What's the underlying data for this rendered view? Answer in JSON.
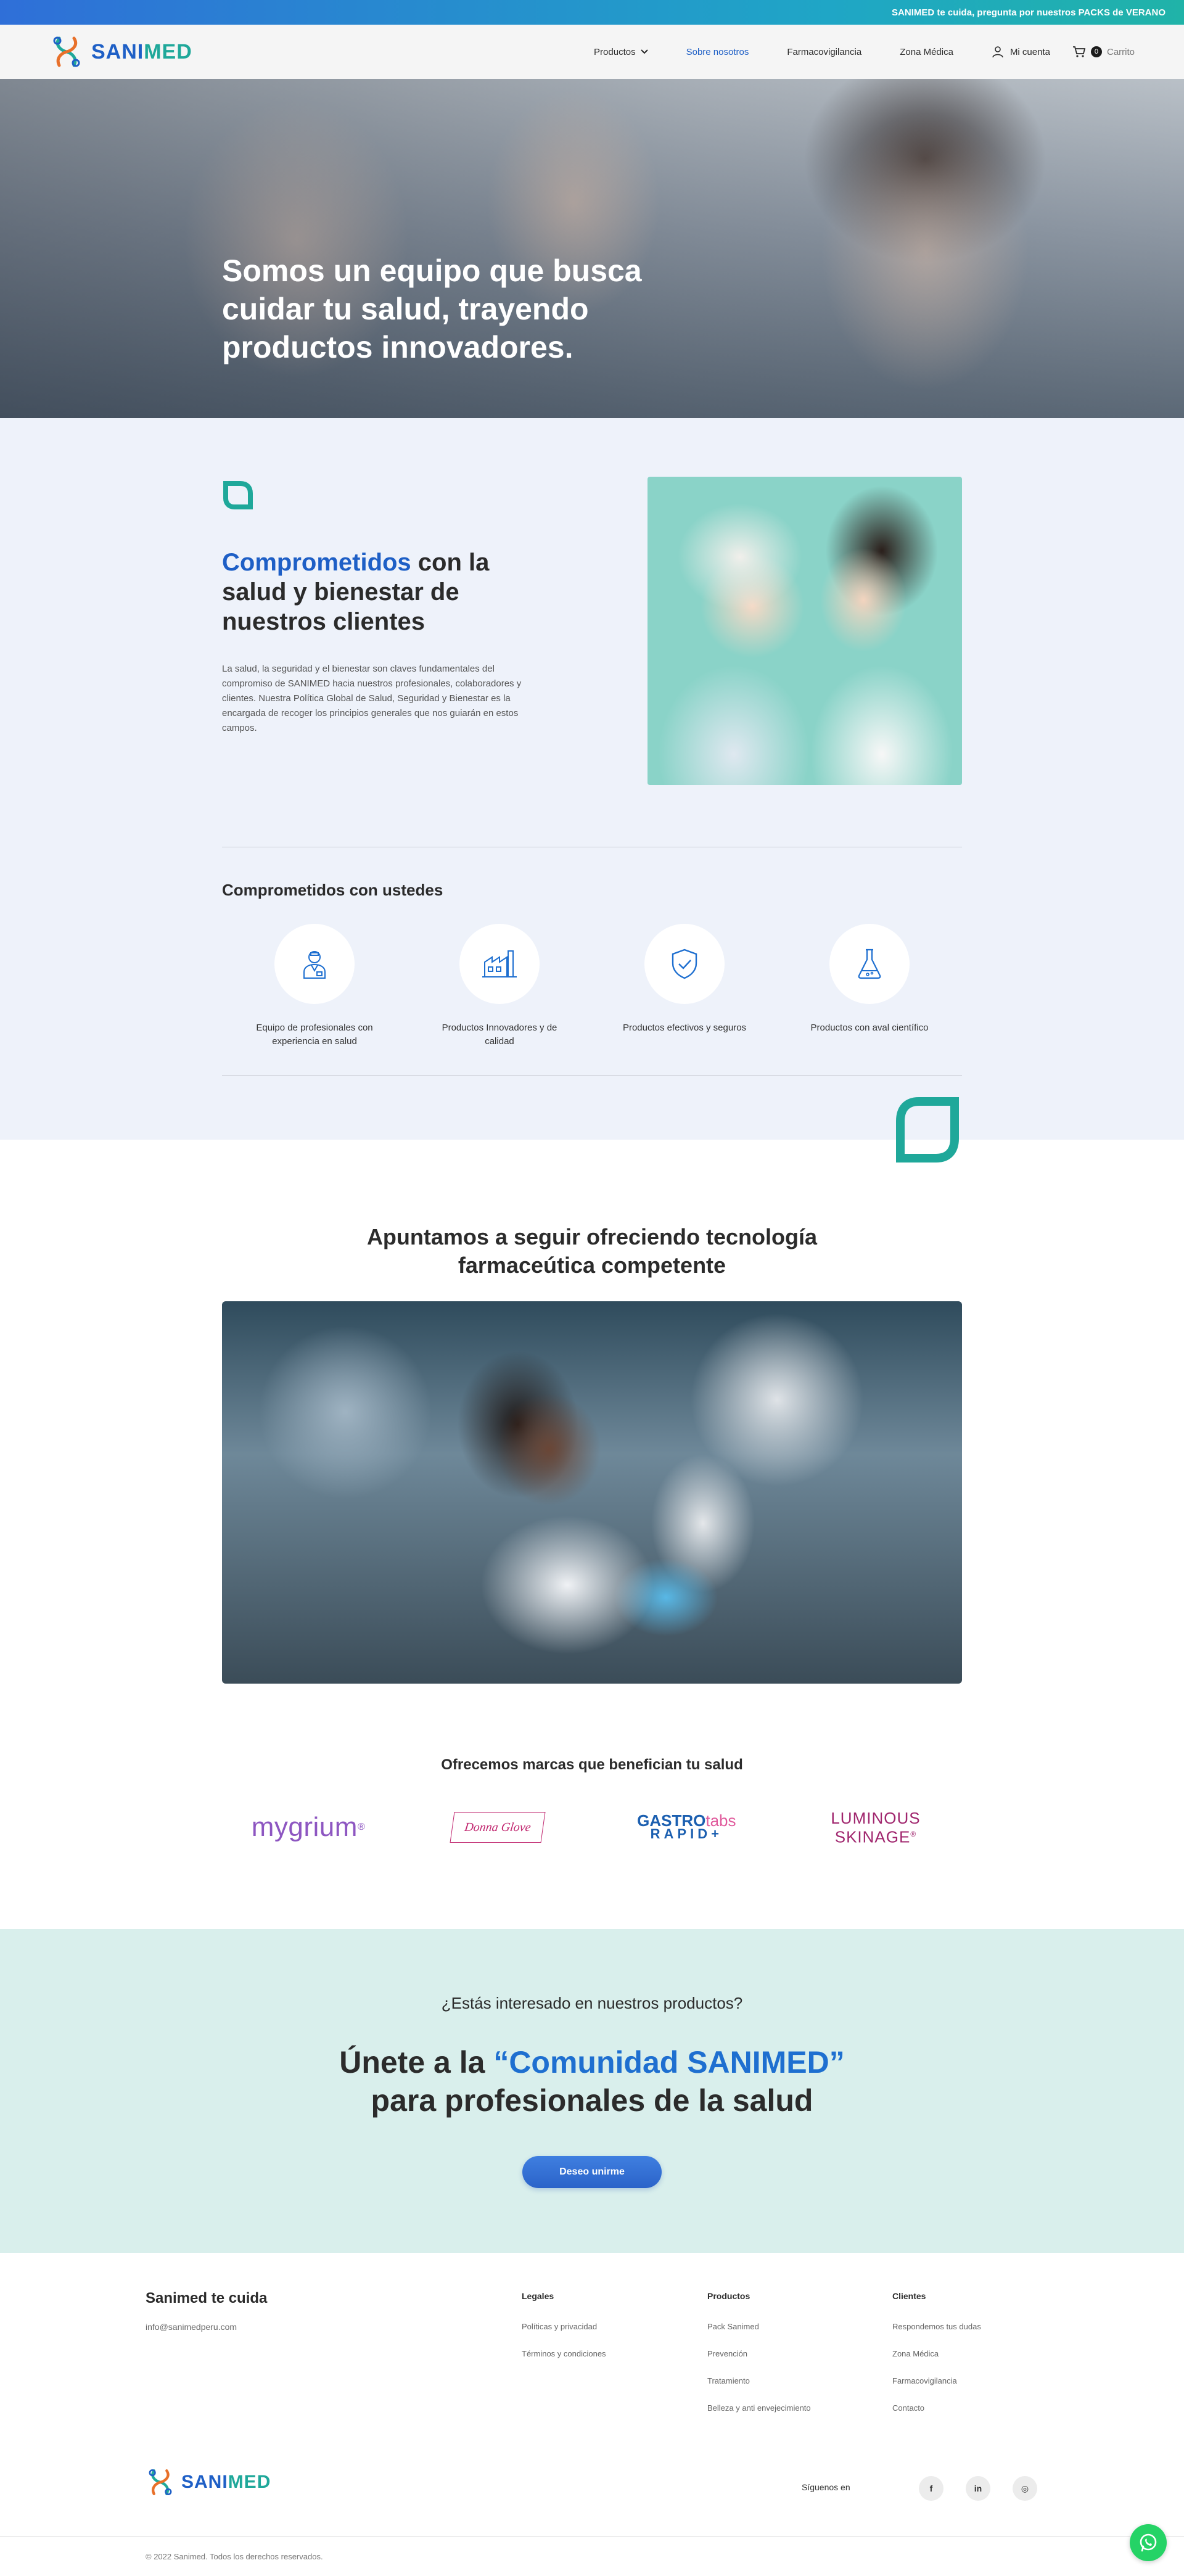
{
  "announcement": "SANIMED te cuida, pregunta por nuestros PACKS de VERANO",
  "brand": {
    "part1": "SANI",
    "part2": "MED",
    "color_primary": "#1e5fc6",
    "color_secondary": "#1fa89a"
  },
  "nav": {
    "items": [
      {
        "label": "Productos",
        "has_dropdown": true
      },
      {
        "label": "Sobre nosotros",
        "active": true
      },
      {
        "label": "Farmacovigilancia"
      },
      {
        "label": "Zona Médica"
      }
    ],
    "account_label": "Mi cuenta",
    "cart_count": "0",
    "cart_label": "Carrito"
  },
  "hero": {
    "title": "Somos un equipo que busca cuidar tu salud, trayendo productos innovadores."
  },
  "commit": {
    "title_highlight": "Comprometidos",
    "title_rest": " con la salud y bienestar de nuestros clientes",
    "text": "La salud, la seguridad y el bienestar son claves fundamentales del compromiso de SANIMED hacia nuestros profesionales, colaboradores y clientes. Nuestra Política Global de Salud, Seguridad y Bienestar es la encargada de recoger los principios generales que nos guiarán en estos campos.",
    "subtitle": "Comprometidos con ustedes",
    "features": [
      {
        "icon": "doctor-icon",
        "label": "Equipo de profesionales con experiencia en salud"
      },
      {
        "icon": "factory-icon",
        "label": "Productos Innovadores y de calidad"
      },
      {
        "icon": "shield-check-icon",
        "label": "Productos efectivos y seguros"
      },
      {
        "icon": "flask-icon",
        "label": "Productos con aval científico"
      }
    ]
  },
  "tech": {
    "title_line1": "Apuntamos a seguir ofreciendo tecnología",
    "title_line2": "farmaceútica competente",
    "brands_title": "Ofrecemos marcas que benefician tu salud",
    "brands": {
      "mygrium": "mygrium",
      "mygrium_mark": "®",
      "donna": "Donna Glove",
      "gastro_1": "GASTRO",
      "gastro_tabs": "tabs",
      "gastro_2": "RAPID+",
      "lumi_1": "LUMINOUS",
      "lumi_2": "SKINAGE",
      "lumi_mark": "®"
    }
  },
  "cta": {
    "question": "¿Estás interesado en nuestros productos?",
    "title_prefix": "Únete a la ",
    "title_highlight": "“Comunidad SANIMED”",
    "title_line2": "para profesionales de la salud",
    "button": "Deseo unirme"
  },
  "footer": {
    "brand_title": "Sanimed te cuida",
    "email": "info@sanimedperu.com",
    "columns": [
      {
        "title": "Legales",
        "links": [
          "Políticas y privacidad",
          "Términos y condiciones"
        ]
      },
      {
        "title": "Productos",
        "links": [
          "Pack Sanimed",
          "Prevención",
          "Tratamiento",
          "Belleza y anti envejecimiento"
        ]
      },
      {
        "title": "Clientes",
        "links": [
          "Respondemos tus dudas",
          "Zona Médica",
          "Farmacovigilancia",
          "Contacto"
        ]
      }
    ],
    "social_label": "Síguenos en",
    "social": [
      "f",
      "in",
      "◎"
    ],
    "copyright": "© 2022 Sanimed. Todos los derechos reservados."
  }
}
